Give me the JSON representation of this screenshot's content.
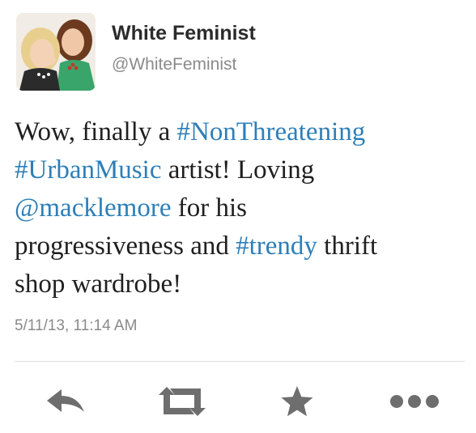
{
  "tweet": {
    "author_name": "White Feminist",
    "author_handle": "@WhiteFeminist",
    "text_lines": [
      [
        {
          "t": "Wow, finally a ",
          "link": false
        },
        {
          "t": "#NonThreatening",
          "link": true
        }
      ],
      [
        {
          "t": "#UrbanMusic",
          "link": true
        },
        {
          "t": " artist! Loving",
          "link": false
        }
      ],
      [
        {
          "t": "@macklemore",
          "link": true
        },
        {
          "t": " for his",
          "link": false
        }
      ],
      [
        {
          "t": "progressiveness and ",
          "link": false
        },
        {
          "t": "#trendy",
          "link": true
        },
        {
          "t": " thrift",
          "link": false
        }
      ],
      [
        {
          "t": "shop wardrobe!",
          "link": false
        }
      ]
    ],
    "timestamp": "5/11/13, 11:14 AM"
  },
  "actions": {
    "reply_icon": "reply-icon",
    "retweet_icon": "retweet-icon",
    "favorite_icon": "star-icon",
    "more_icon": "more-icon",
    "icon_color": "#6e6e6e"
  },
  "colors": {
    "link": "#2d7fb8",
    "text": "#1f1f1f",
    "muted": "#8a8a8a",
    "divider": "#dcdcdc"
  }
}
